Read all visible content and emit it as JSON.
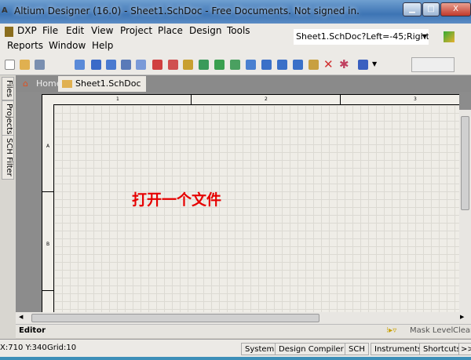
{
  "window": {
    "title": "Altium Designer (16.0) - Sheet1.SchDoc - Free Documents. Not signed in.",
    "minimize": "▁",
    "maximize": "□",
    "close": "X"
  },
  "menu": [
    "DXP",
    "File",
    "Edit",
    "View",
    "Project",
    "Place",
    "Design",
    "Tools",
    "Reports",
    "Window",
    "Help"
  ],
  "location_combo": "Sheet1.SchDoc?Left=-45;Right=",
  "tabs": [
    {
      "label": "Home"
    },
    {
      "label": "Sheet1.SchDoc"
    }
  ],
  "left_panels": [
    "Files",
    "Projects",
    "SCH Filter"
  ],
  "sheet": {
    "columns": [
      "1",
      "2",
      "3"
    ],
    "rows": [
      "A",
      "B"
    ],
    "annotation": "打开一个文件",
    "annotation_color": "#e60000"
  },
  "editor": {
    "label": "Editor",
    "mask_level": "Mask Level",
    "clear": "Clear"
  },
  "status": {
    "coords": "X:710 Y:340",
    "grid": "Grid:10",
    "buttons": [
      "System",
      "Design Compiler",
      "SCH",
      "Instruments",
      "Shortcuts",
      ">>"
    ]
  }
}
